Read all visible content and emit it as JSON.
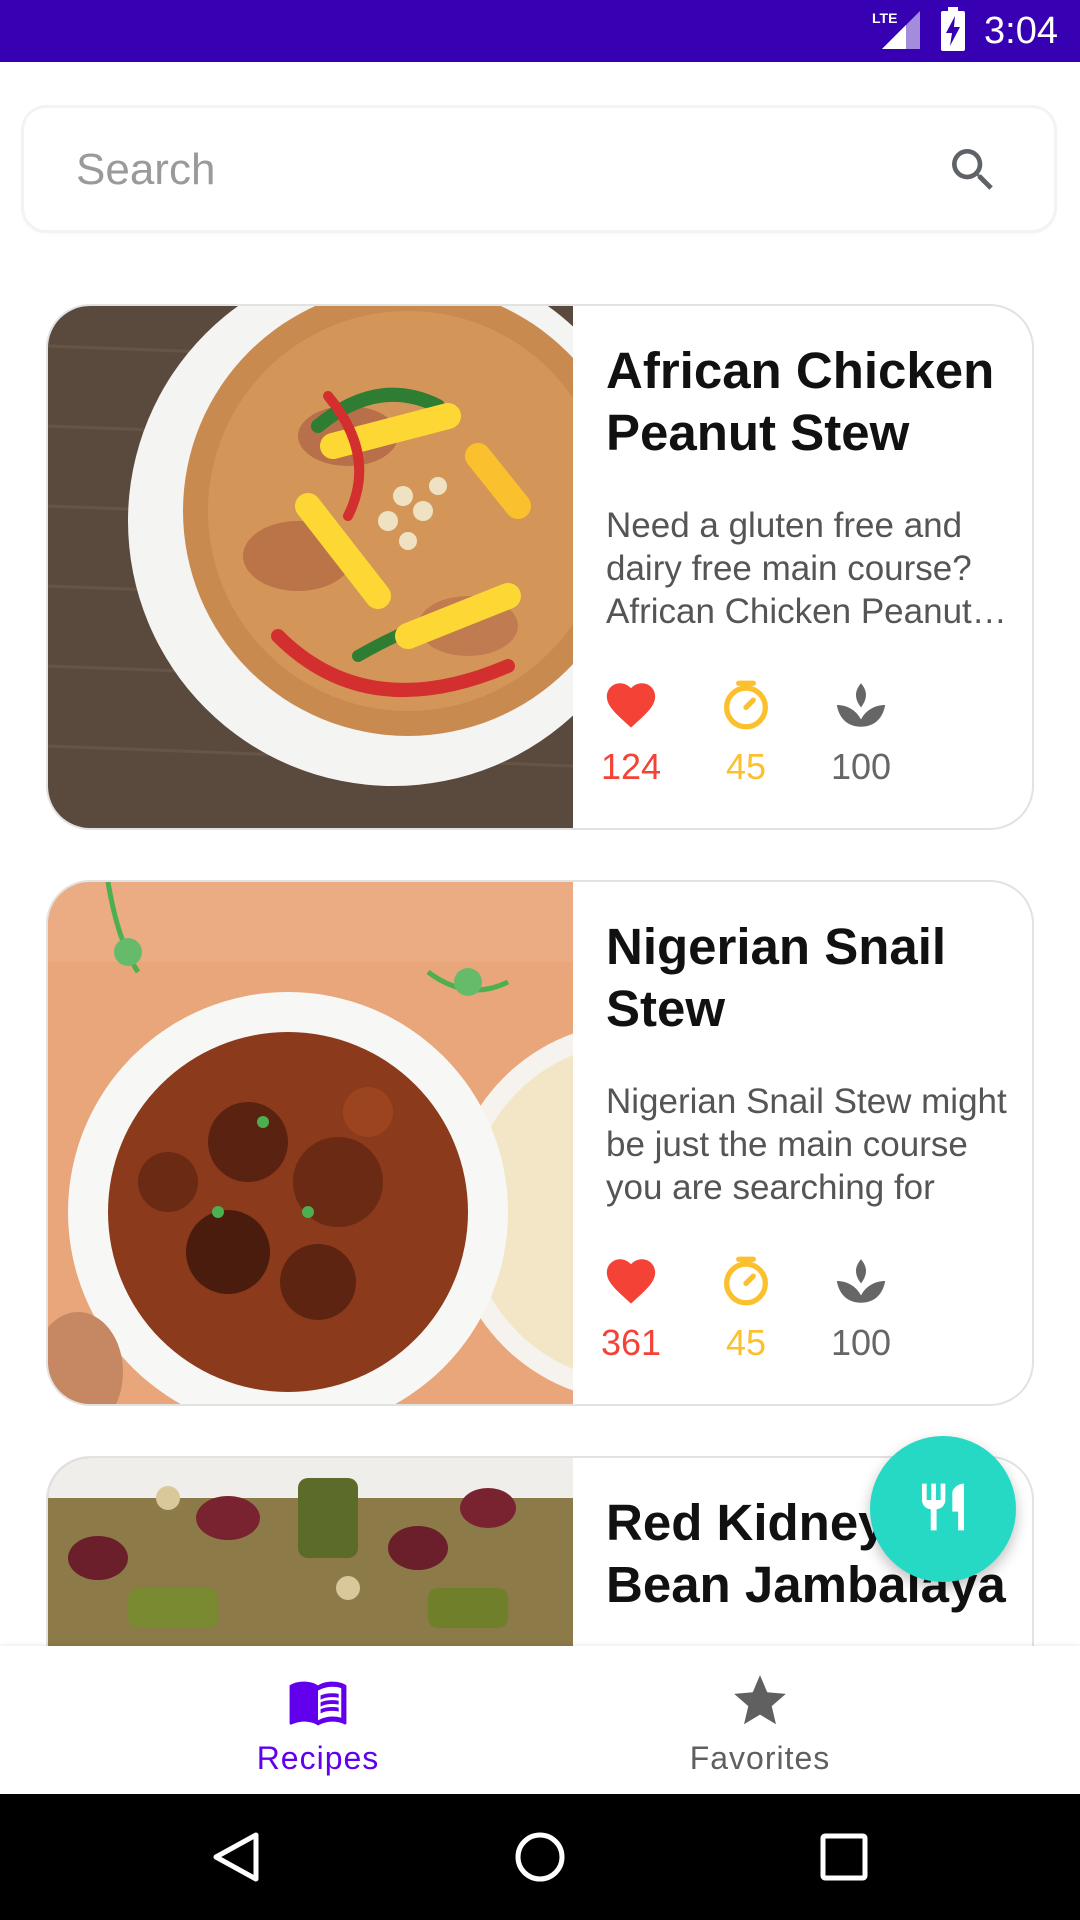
{
  "status_bar": {
    "time": "3:04",
    "network": "LTE"
  },
  "search": {
    "placeholder": "Search"
  },
  "recipes": [
    {
      "title": "African Chicken Peanut Stew",
      "description": "Need a gluten free and dairy free main course? African Chicken Peanut Stew",
      "likes": "124",
      "minutes": "45",
      "health_score": "100"
    },
    {
      "title": "Nigerian Snail Stew",
      "description": "Nigerian Snail Stew might be just the main course you are searching for",
      "likes": "361",
      "minutes": "45",
      "health_score": "100"
    },
    {
      "title": "Red Kidney Bean Jambalaya",
      "description": "",
      "likes": "",
      "minutes": "",
      "health_score": ""
    }
  ],
  "bottom_nav": [
    {
      "label": "Recipes",
      "icon": "menu-book-icon",
      "selected": true
    },
    {
      "label": "Favorites",
      "icon": "star-icon",
      "selected": false
    }
  ],
  "colors": {
    "primary": "#3700b3",
    "accent": "#26d9c4",
    "heart": "#f44336",
    "clock": "#fbc02d",
    "leaf": "#666666"
  }
}
